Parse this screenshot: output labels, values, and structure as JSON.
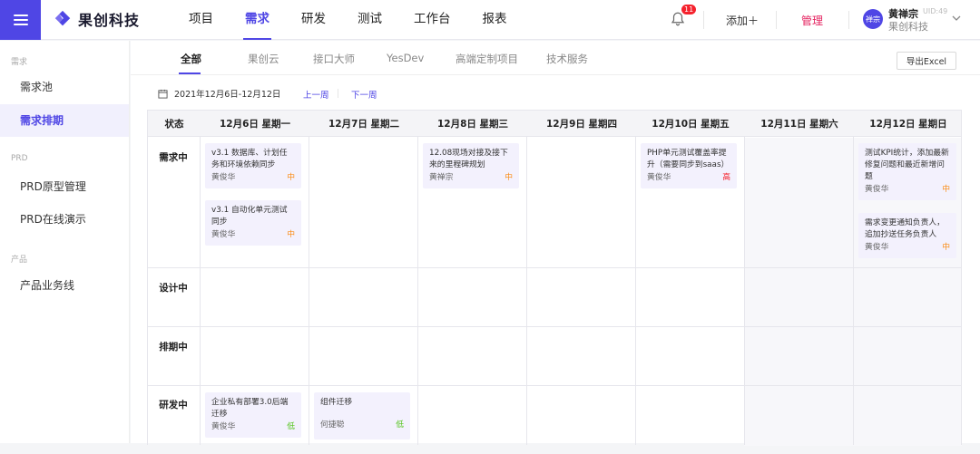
{
  "header": {
    "logo_text": "果创科技",
    "nav": [
      "项目",
      "需求",
      "研发",
      "测试",
      "工作台",
      "报表"
    ],
    "active_nav": 1,
    "notification_count": "11",
    "add_label": "添加＋",
    "admin_label": "管理",
    "avatar_text": "禅宗",
    "user_name": "黄禅宗",
    "user_uid": "UID:49",
    "user_company": "果创科技"
  },
  "sidebar": {
    "groups": [
      {
        "label": "需求",
        "items": [
          "需求池",
          "需求排期"
        ]
      },
      {
        "label": "PRD",
        "items": [
          "PRD原型管理",
          "PRD在线演示"
        ]
      },
      {
        "label": "产品",
        "items": [
          "产品业务线"
        ]
      }
    ],
    "active_item": "需求排期"
  },
  "tabs": [
    "全部",
    "果创云",
    "接口大师",
    "YesDev",
    "高端定制项目",
    "技术服务"
  ],
  "active_tab": 0,
  "export_label": "导出Excel",
  "date_range": "2021年12月6日-12月12日",
  "prev_week": "上一周",
  "next_week": "下一周",
  "table": {
    "status_header": "状态",
    "days": [
      "12月6日 星期一",
      "12月7日 星期二",
      "12月8日 星期三",
      "12月9日 星期四",
      "12月10日 星期五",
      "12月11日 星期六",
      "12月12日 星期日"
    ],
    "statuses": [
      "需求中",
      "设计中",
      "排期中",
      "研发中"
    ]
  },
  "cards": [
    {
      "title": "v3.1 数据库、计划任务和环境依赖同步",
      "owner": "黄俊华",
      "priority": "中"
    },
    {
      "title": "v3.1 自动化单元测试同步",
      "owner": "黄俊华",
      "priority": "中"
    },
    {
      "title": "12.08现场对接及接下来的里程碑规划",
      "owner": "黄禅宗",
      "priority": "中"
    },
    {
      "title": "PHP单元测试覆盖率提升（需要同步到saas）",
      "owner": "黄俊华",
      "priority": "高"
    },
    {
      "title": "测试KPI统计，添加最新修复问题和最近新增问题",
      "owner": "黄俊华",
      "priority": "中"
    },
    {
      "title": "需求变更通知负责人，追加抄送任务负责人",
      "owner": "黄俊华",
      "priority": "中"
    },
    {
      "title": "企业私有部署3.0后端迁移",
      "owner": "黄俊华",
      "priority": "低"
    },
    {
      "title": "组件迁移",
      "owner": "何捷聪",
      "priority": "低"
    }
  ],
  "colors": {
    "accent": "#4f46e5",
    "admin": "#e4215e",
    "priority_mid": "#fa8c16",
    "priority_high": "#f5222d",
    "priority_low": "#52c41a"
  }
}
